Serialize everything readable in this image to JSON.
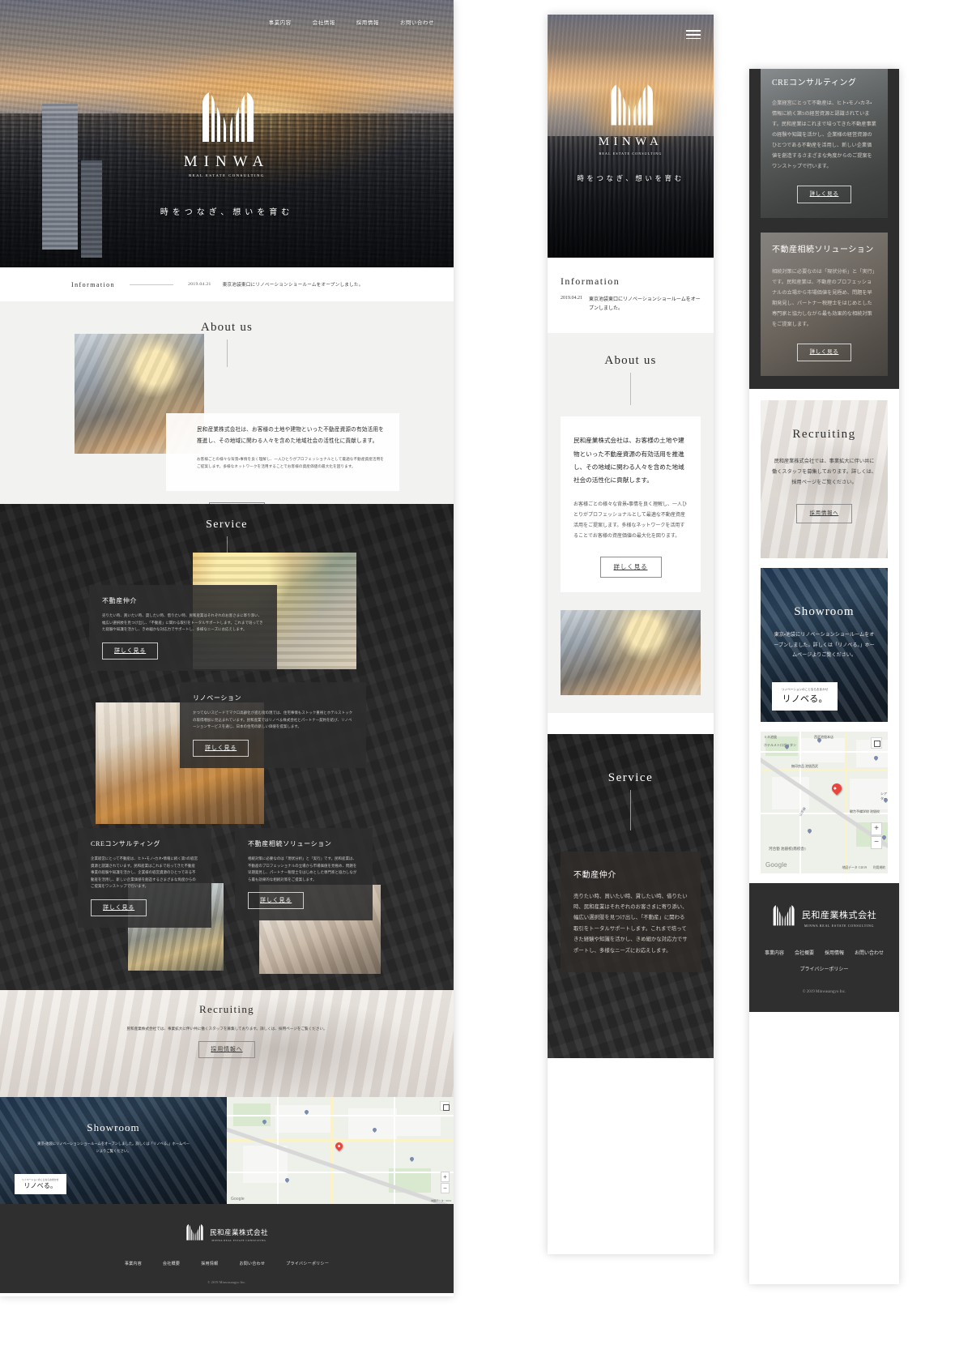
{
  "brand": {
    "name_en": "MINWA",
    "tagline_en": "REAL ESTATE CONSULTING",
    "tagline_jp": "時をつなぎ、想いを育む",
    "company_jp": "民和産業株式会社",
    "company_en": "MINWA REAL ESTATE CONSULTING",
    "copyright": "© 2019 Minwasangyo Inc."
  },
  "nav": {
    "items": [
      {
        "label": "事業内容"
      },
      {
        "label": "会社情報"
      },
      {
        "label": "採用情報"
      },
      {
        "label": "お問い合わせ"
      }
    ]
  },
  "information": {
    "title": "Information",
    "date": "2019.04.21",
    "text": "東京池袋東口にリノベーションショールームをオープンしました。"
  },
  "about": {
    "title": "About us",
    "lead": "民和産業株式会社は、お客様の土地や建物といった不動産資源の有効活用を推進し、その地域に関わる人々を含めた地域社会の活性化に貢献します。",
    "body": "お客様ごとの様々な背景・事情を良く理解し、一人ひとりがプロフェッショナルとして最適な不動産資産活用をご提案します。多様なネットワークを活用することでお客様の資産価値の最大化を図ります。",
    "button": "詳しく見る"
  },
  "service": {
    "title": "Service",
    "cards": [
      {
        "title": "不動産仲介",
        "body": "売りたい時、買いたい時、貸したい時、借りたい時、民和産業はそれぞれのお客さまに寄り添い、幅広い選択肢を見つけ出し、「不動産」に関わる取引をトータルサポートします。これまで培ってきた経験や知識を活かし、きめ細かな対応力でサポートし、多様なニーズにお応えします。",
        "button": "詳しく見る"
      },
      {
        "title": "リノベーション",
        "body": "かつてないスピードでマクロ高齢化が進む街の現では、住宅事情もストック重視とホテルストックの取得増加に見込まれています。民和産業ではリノベ＆株式会社とパートナー契約を結び、リノベーションサービスを通じ、日本の住宅の新しい価値を提案します。",
        "button": "詳しく見る"
      },
      {
        "title": "CREコンサルティング",
        "body": "企業経営にとって不動産は、ヒト・モノ・カネ・情報に続く第5の経営資源と認識されています。民和産業はこれまで培ってきた不動産事業の経験や知識を活かし、企業様の経営資源のひとつである不動産を活用し、新しい企業価値を創造するさまざまな角度からのご提案をワンストップで行います。",
        "button": "詳しく見る"
      },
      {
        "title": "不動産相続ソリューション",
        "body": "相続対策に必要なのは「現状分析」と「実行」です。民和産業は、不動産のプロフェッショナルの立場から市場価値を見極め、問題を早期発見し、パートナー税理士をはじめとした専門家と協力しながら最も効果的な相続対策をご提案します。",
        "button": "詳しく見る"
      }
    ]
  },
  "recruiting": {
    "title": "Recruiting",
    "body": "民和産業株式会社では、事業拡大に伴い共に働くスタッフを募集しております。詳しくは、採用ページをご覧ください。",
    "button": "採用情報へ"
  },
  "showroom": {
    "title": "Showroom",
    "body": "東京・池袋にリノベーションショールームをオープンしました。詳しくは「リノベる。」ホームページよりご覧ください。",
    "badge_small": "リノベーションのことならおまかせ",
    "badge_big": "リノベる。"
  },
  "map": {
    "labels": [
      "ミネ池袋",
      "西武池袋本店",
      "ホテルメトロポリタン",
      "無印良品 池袋西武",
      "シアター",
      "駿台予備学校 池袋校",
      "河合塾 池袋校[南校舎]",
      "山手線",
      "南"
    ],
    "provider": "Google",
    "attribution": "地図データ ©2019",
    "terms": "利用規約",
    "zoom_in": "+",
    "zoom_out": "−"
  },
  "footer": {
    "links": [
      {
        "label": "事業内容"
      },
      {
        "label": "会社概要"
      },
      {
        "label": "採用情報"
      },
      {
        "label": "お問い合わせ"
      },
      {
        "label": "プライバシーポリシー"
      }
    ]
  },
  "icons": {
    "hamburger": "hamburger-icon",
    "logo": "minwa-logo-icon",
    "map_pin": "map-pin-icon",
    "fullscreen": "fullscreen-icon"
  }
}
